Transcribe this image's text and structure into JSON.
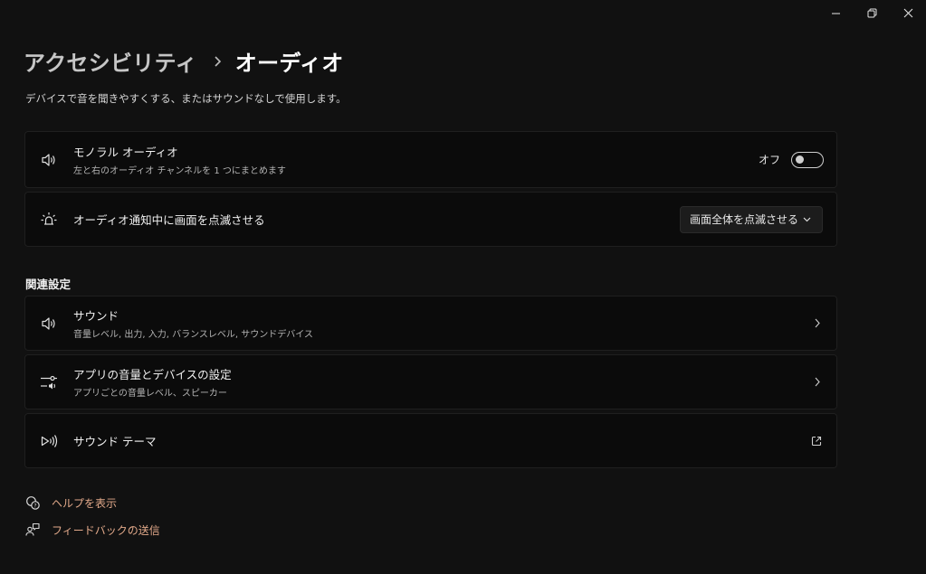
{
  "window": {
    "controls": [
      "minimize-icon",
      "restore-icon",
      "close-icon"
    ]
  },
  "breadcrumb": {
    "parent": "アクセシビリティ",
    "current": "オーディオ"
  },
  "description": "デバイスで音を聞きやすくする、またはサウンドなしで使用します。",
  "settings": {
    "mono_audio": {
      "icon": "speaker-icon",
      "title": "モノラル オーディオ",
      "subtitle": "左と右のオーディオ チャンネルを 1 つにまとめます",
      "toggle_state": "オフ",
      "enabled": false
    },
    "flash_screen": {
      "icon": "flash-bulb-icon",
      "title": "オーディオ通知中に画面を点滅させる",
      "selected": "画面全体を点滅させる"
    }
  },
  "related": {
    "header": "関連設定",
    "items": [
      {
        "icon": "speaker-icon",
        "title": "サウンド",
        "subtitle": "音量レベル, 出力, 入力, バランスレベル, サウンドデバイス"
      },
      {
        "icon": "mixer-icon",
        "title": "アプリの音量とデバイスの設定",
        "subtitle": "アプリごとの音量レベル、スピーカー"
      },
      {
        "icon": "sound-theme-icon",
        "title": "サウンド テーマ"
      }
    ]
  },
  "footer": {
    "help": "ヘルプを表示",
    "feedback": "フィードバックの送信"
  },
  "colors": {
    "background": "#111111",
    "card": "#0b0b0b",
    "accent_link": "#e2a98a"
  }
}
